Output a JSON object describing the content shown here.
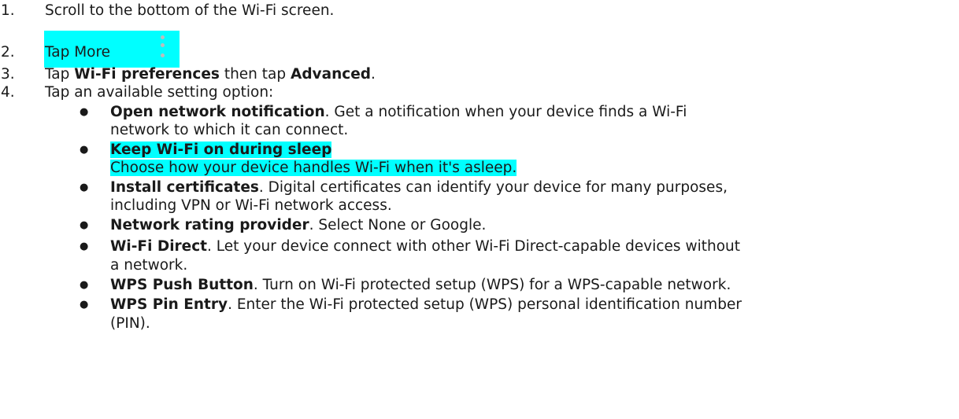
{
  "steps": [
    {
      "num": "1.",
      "text": "Scroll to the bottom of the Wi-Fi screen."
    },
    {
      "num": "2.",
      "text": "Tap More",
      "icon": "more-vert-icon"
    },
    {
      "num": "3.",
      "pre": "Tap ",
      "bold1": "Wi-Fi preferences",
      "mid": " then tap ",
      "bold2": "Advanced",
      "post": "."
    },
    {
      "num": "4.",
      "text": "Tap an available setting option:"
    }
  ],
  "options": [
    {
      "title": "Open network notification",
      "line1": ". Get a notification when your device finds a Wi-Fi",
      "line2": "network to which it can connect."
    },
    {
      "title": "Keep Wi-Fi on during sleep",
      "line2": "Choose how your device handles Wi-Fi when it's asleep."
    },
    {
      "title": "Install certificates",
      "line1": ". Digital certificates can identify your device for many purposes,",
      "line2": "including VPN or Wi-Fi network access."
    },
    {
      "title": "Network rating provider",
      "line1": ". Select None or Google."
    },
    {
      "title": "Wi-Fi Direct",
      "line1": ". Let your device connect with other Wi-Fi Direct-capable devices without",
      "line2": "a network."
    },
    {
      "title": "WPS Push Button",
      "line1": ". Turn on Wi-Fi protected setup (WPS) for a WPS-capable network."
    },
    {
      "title": "WPS Pin Entry",
      "line1": ". Enter the Wi-Fi protected setup (WPS) personal identification number",
      "line2": "(PIN)."
    }
  ],
  "colors": {
    "highlight": "#00ffff",
    "text": "#1a1a1a",
    "icon": "#bdbdbd"
  }
}
